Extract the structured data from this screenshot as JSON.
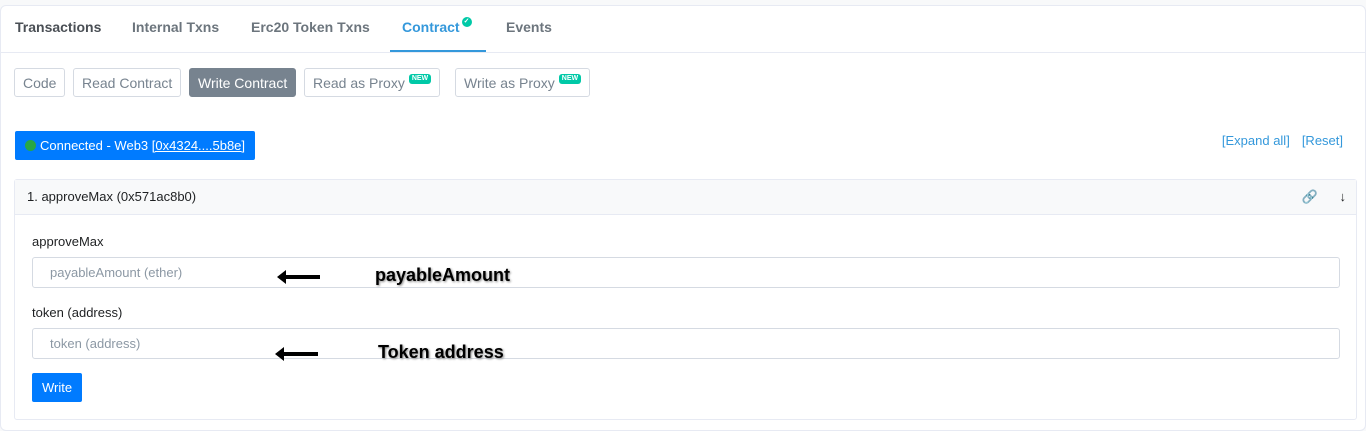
{
  "tabs": [
    "Transactions",
    "Internal Txns",
    "Erc20 Token Txns",
    "Contract",
    "Events"
  ],
  "subtabs": {
    "code": "Code",
    "read": "Read Contract",
    "write": "Write Contract",
    "read_proxy": "Read as Proxy",
    "write_proxy": "Write as Proxy",
    "new_badge": "NEW"
  },
  "connection": {
    "label": "Connected - Web3 ",
    "address": "[0x4324....5b8e]"
  },
  "links": {
    "expand": "[Expand all]",
    "reset": "[Reset]"
  },
  "method": {
    "title": "1. approveMax (0x571ac8b0)",
    "section_label": "approveMax",
    "field1_placeholder": "payableAmount (ether)",
    "field2_label": "token (address)",
    "field2_placeholder": "token (address)",
    "write": "Write"
  },
  "annotations": {
    "a1": "payableAmount",
    "a2": "Token address"
  }
}
